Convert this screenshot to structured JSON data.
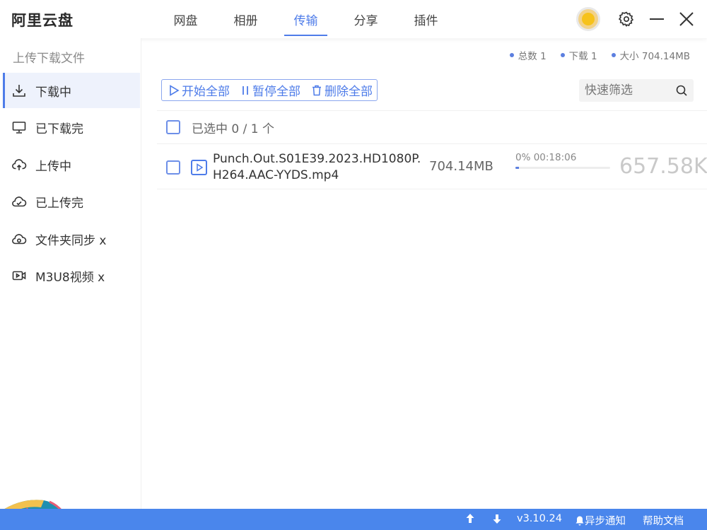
{
  "header": {
    "title": "阿里云盘",
    "tabs": [
      {
        "label": "网盘"
      },
      {
        "label": "相册"
      },
      {
        "label": "传输"
      },
      {
        "label": "分享"
      },
      {
        "label": "插件"
      }
    ],
    "active_tab": "传输",
    "accent_color": "#4e7ce9"
  },
  "sidebar": {
    "title": "上传下载文件",
    "items": [
      {
        "label": "下载中",
        "icon": "download-icon"
      },
      {
        "label": "已下载完",
        "icon": "monitor-icon"
      },
      {
        "label": "上传中",
        "icon": "cloud-upload-icon"
      },
      {
        "label": "已上传完",
        "icon": "cloud-done-icon"
      },
      {
        "label": "文件夹同步 x",
        "icon": "cloud-sync-icon"
      },
      {
        "label": "M3U8视频 x",
        "icon": "video-icon"
      }
    ]
  },
  "stats": {
    "total": "总数 1",
    "download": "下载 1",
    "size": "大小 704.14MB"
  },
  "toolbar": {
    "start_all": "开始全部",
    "pause_all": "暂停全部",
    "delete_all": "删除全部",
    "filter_placeholder": "快速筛选"
  },
  "selection": {
    "text": "已选中 0 / 1 个"
  },
  "files": [
    {
      "name_line1": "Punch.Out.S01E39.2023.HD1080P.",
      "name_line2": "H264.AAC-YYDS.mp4",
      "size": "704.14MB",
      "progress_text": "0% 00:18:06",
      "progress_fraction": 0.04,
      "speed": "657.58K"
    }
  ],
  "statusbar": {
    "version": "v3.10.24",
    "async_notify": "异步通知",
    "help": "帮助文档",
    "color": "#4a86ec"
  }
}
